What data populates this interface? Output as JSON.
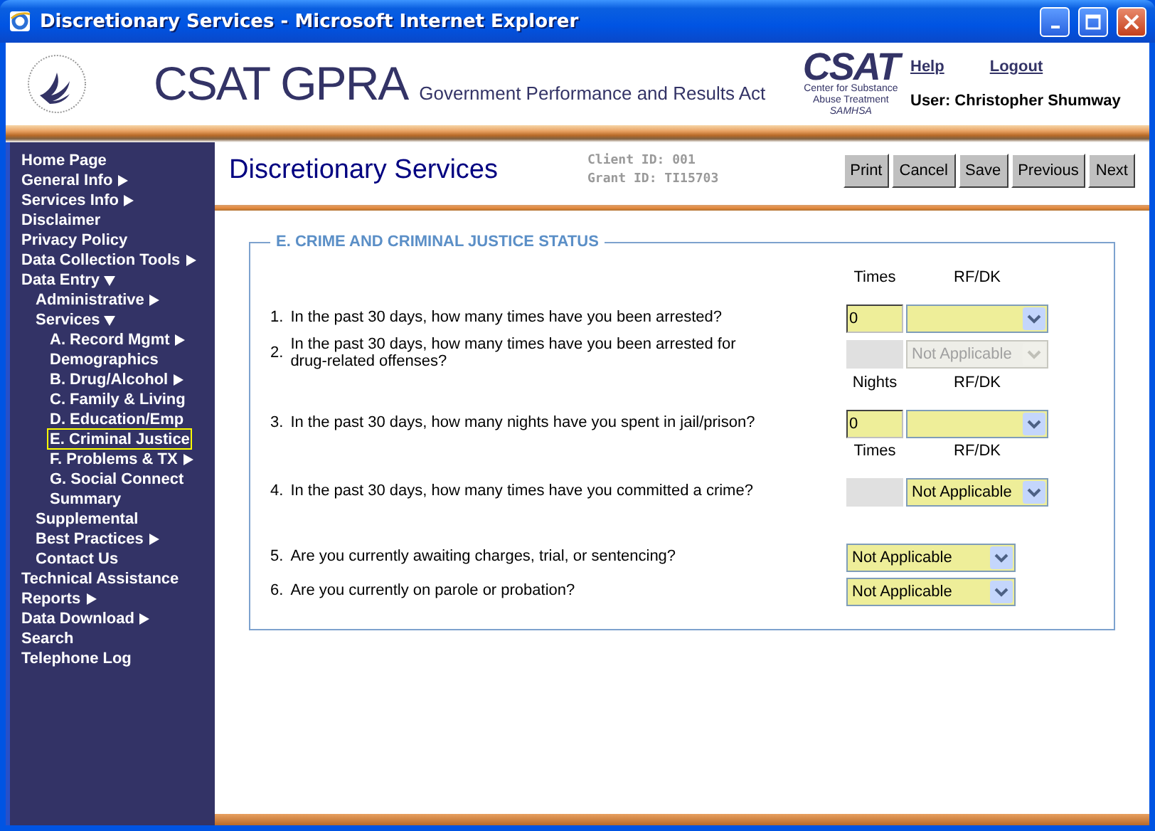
{
  "window": {
    "title": "Discretionary Services - Microsoft Internet Explorer"
  },
  "header": {
    "app_name": "CSAT GPRA",
    "app_subtitle": "Government Performance and Results Act",
    "agency_logo": {
      "name": "CSAT",
      "lines": [
        "Center for Substance",
        "Abuse Treatment",
        "SAMHSA"
      ]
    },
    "links": [
      "Help",
      "Logout"
    ],
    "user": "User: Christopher Shumway"
  },
  "sidebar": {
    "items": [
      {
        "label": "Home Page",
        "has_submenu": false
      },
      {
        "label": "General Info",
        "has_submenu": true
      },
      {
        "label": "Services Info",
        "has_submenu": true
      },
      {
        "label": "Disclaimer",
        "has_submenu": false
      },
      {
        "label": "Privacy Policy",
        "has_submenu": false
      },
      {
        "label": "Data Collection Tools",
        "has_submenu": true
      },
      {
        "label": "Data Entry",
        "expanded": true,
        "children": [
          {
            "label": "Administrative",
            "has_submenu": true
          },
          {
            "label": "Services",
            "expanded": true,
            "children": [
              {
                "label": "A. Record Mgmt",
                "has_submenu": true,
                "selected": false
              },
              {
                "label": "Demographics",
                "has_submenu": false,
                "selected": false
              },
              {
                "label": "B. Drug/Alcohol",
                "has_submenu": true,
                "selected": false
              },
              {
                "label": "C. Family & Living",
                "has_submenu": false,
                "selected": false
              },
              {
                "label": "D. Education/Emp",
                "has_submenu": false,
                "selected": false
              },
              {
                "label": "E. Criminal Justice",
                "has_submenu": false,
                "selected": true
              },
              {
                "label": "F. Problems & TX",
                "has_submenu": true,
                "selected": false
              },
              {
                "label": "G. Social Connect",
                "has_submenu": false,
                "selected": false
              },
              {
                "label": "Summary",
                "has_submenu": false,
                "selected": false
              }
            ]
          },
          {
            "label": "Supplemental",
            "has_submenu": false
          },
          {
            "label": "Best Practices",
            "has_submenu": true
          },
          {
            "label": "Contact Us",
            "has_submenu": false
          }
        ]
      },
      {
        "label": "Technical Assistance",
        "has_submenu": false
      },
      {
        "label": "Reports",
        "has_submenu": true
      },
      {
        "label": "Data Download",
        "has_submenu": true
      },
      {
        "label": "Search",
        "has_submenu": false
      },
      {
        "label": "Telephone Log",
        "has_submenu": false
      }
    ]
  },
  "page": {
    "title": "Discretionary Services",
    "client_id": "Client ID: 001",
    "grant_id": "Grant ID: TI15703",
    "buttons": [
      "Print",
      "Cancel",
      "Save",
      "Previous",
      "Next"
    ]
  },
  "section": {
    "title": "E. CRIME AND CRIMINAL JUSTICE STATUS",
    "questions": [
      {
        "kind": "count",
        "number": "1.",
        "text": "In the past 30 days, how many times have you been arrested?",
        "column_headers": [
          "Times",
          "RF/DK"
        ],
        "count": {
          "value": "0",
          "disabled": false
        },
        "select": {
          "disabled": false
        }
      },
      {
        "kind": "count",
        "number": "2.",
        "text": "In the past 30 days, how many times have you been arrested for drug-related offenses?",
        "count": {
          "disabled": true
        },
        "select": {
          "value": "Not Applicable",
          "disabled": true
        }
      },
      {
        "kind": "count",
        "number": "3.",
        "text": "In the past 30 days, how many nights have you spent in jail/prison?",
        "column_headers": [
          "Nights",
          "RF/DK"
        ],
        "count": {
          "value": "0",
          "disabled": false
        },
        "select": {
          "disabled": false
        }
      },
      {
        "kind": "count",
        "number": "4.",
        "text": "In the past 30 days, how many times have you committed a crime?",
        "column_headers": [
          "Times",
          "RF/DK"
        ],
        "count": {
          "disabled": true
        },
        "select": {
          "value": "Not Applicable",
          "disabled": false
        }
      },
      {
        "kind": "choice",
        "number": "5.",
        "text": "Are you currently awaiting charges, trial, or sentencing?",
        "select": {
          "value": "Not Applicable",
          "disabled": false
        }
      },
      {
        "kind": "choice",
        "number": "6.",
        "text": "Are you currently on parole or probation?",
        "select": {
          "value": "Not Applicable",
          "disabled": false
        }
      }
    ]
  }
}
